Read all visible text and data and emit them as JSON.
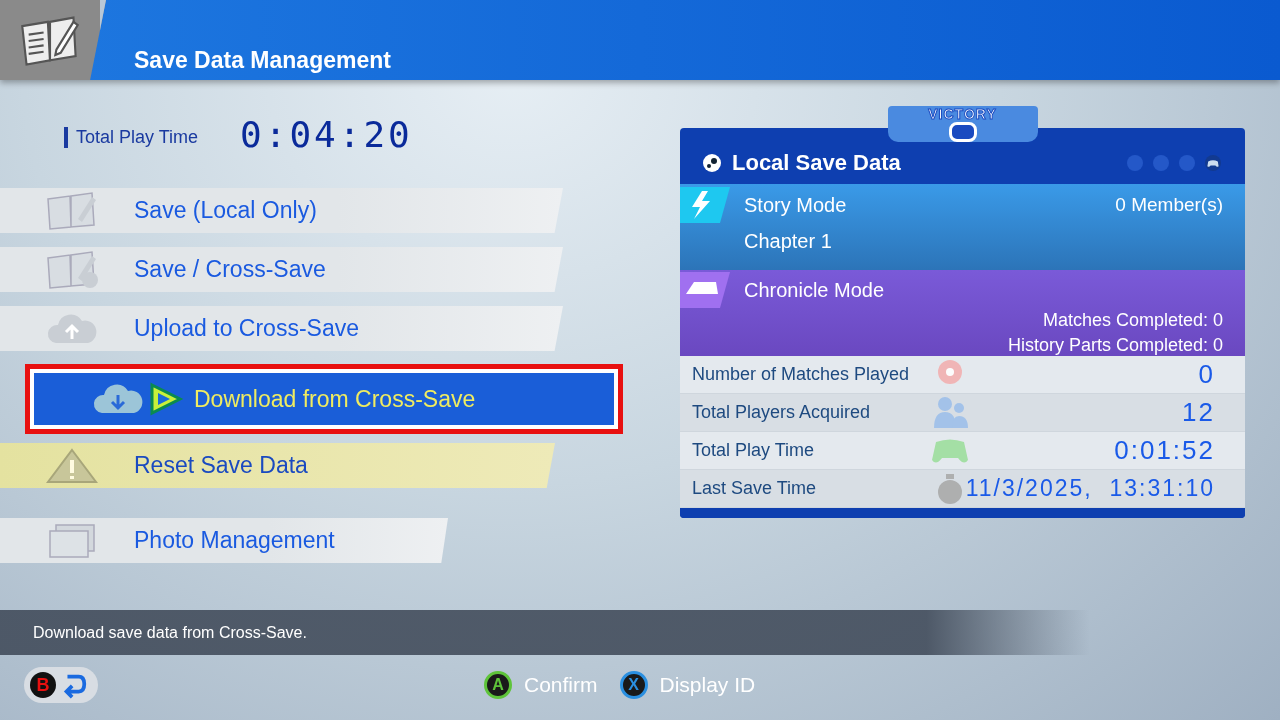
{
  "header": {
    "title": "Save Data Management"
  },
  "play_time": {
    "label": "Total Play Time",
    "value": "0:04:20"
  },
  "menu": [
    {
      "kind": "save",
      "label": "Save (Local Only)",
      "selected": false
    },
    {
      "kind": "cross",
      "label": "Save / Cross-Save",
      "selected": false
    },
    {
      "kind": "upload",
      "label": "Upload to Cross-Save",
      "selected": false
    },
    {
      "kind": "download",
      "label": "Download from Cross-Save",
      "selected": true
    },
    {
      "kind": "reset",
      "label": "Reset Save Data",
      "selected": false
    },
    {
      "kind": "photo",
      "label": "Photo Management",
      "selected": false
    }
  ],
  "card": {
    "logo": "VICTORY",
    "title": "Local Save Data",
    "pages": [
      {
        "selected": false
      },
      {
        "selected": false
      },
      {
        "selected": false
      },
      {
        "selected": true
      }
    ],
    "story": {
      "title": "Story Mode",
      "members": "0 Member(s)",
      "chapter": "Chapter 1"
    },
    "chronicle": {
      "title": "Chronicle Mode",
      "lines": [
        "Matches Completed: 0",
        "History Parts Completed: 0"
      ]
    },
    "stats": [
      {
        "kind": "ball",
        "label": "Number of Matches Played",
        "value": "0"
      },
      {
        "kind": "players",
        "label": "Total Players Acquired",
        "value": "12"
      },
      {
        "kind": "controller",
        "label": "Total Play Time",
        "value": "0:01:52"
      },
      {
        "kind": "clock",
        "label": "Last Save Time",
        "value": "11/3/2025,  13:31:10"
      }
    ]
  },
  "help": "Download save data from Cross-Save.",
  "back": {
    "button": "B"
  },
  "hints": [
    {
      "button": "A",
      "label": "Confirm",
      "color": "#5ec43a"
    },
    {
      "button": "X",
      "label": "Display ID",
      "color": "#2a8fe0"
    }
  ]
}
